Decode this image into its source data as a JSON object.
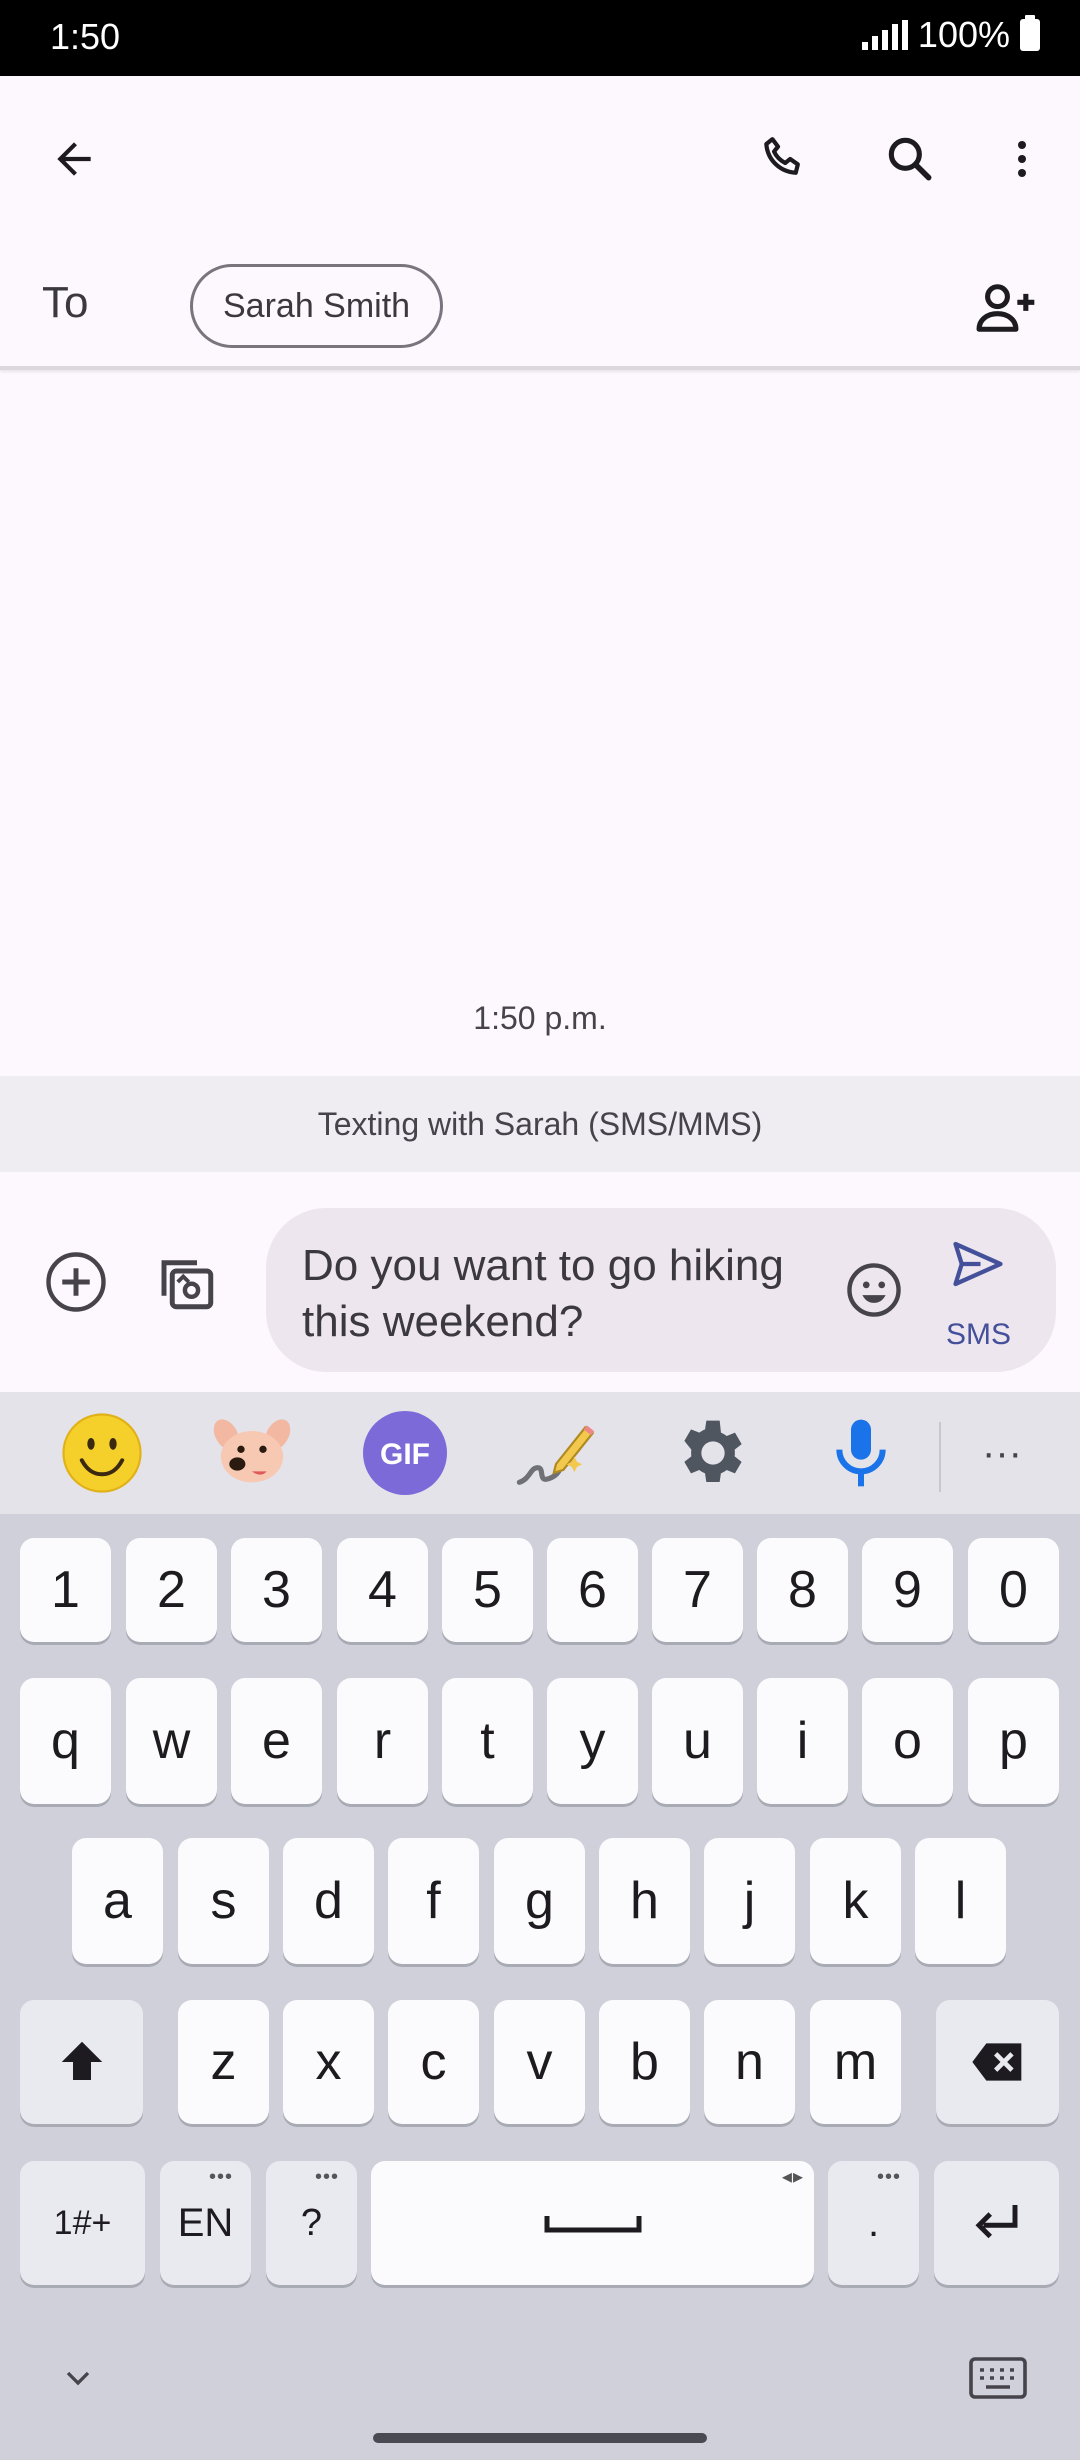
{
  "status_bar": {
    "time": "1:50",
    "battery": "100%"
  },
  "app_bar": {
    "back_icon": "arrow-back-icon",
    "call_icon": "phone-icon",
    "search_icon": "search-icon",
    "more_icon": "more-vert-icon"
  },
  "recipient": {
    "to_label": "To",
    "chip": "Sarah Smith",
    "add_icon": "add-person-icon"
  },
  "conversation": {
    "timestamp": "1:50 p.m.",
    "banner": "Texting with Sarah (SMS/MMS)"
  },
  "compose": {
    "message": "Do you want to go hiking this weekend?",
    "send_label": "SMS",
    "accent": "#44519a"
  },
  "keyboard": {
    "toolbar": [
      "emoji-icon",
      "sticker-icon",
      "gif-icon",
      "handwriting-icon",
      "settings-icon",
      "mic-icon",
      "more-icon"
    ],
    "gif_label": "GIF",
    "more_label": "···",
    "number_row": [
      "1",
      "2",
      "3",
      "4",
      "5",
      "6",
      "7",
      "8",
      "9",
      "0"
    ],
    "row1": [
      "q",
      "w",
      "e",
      "r",
      "t",
      "y",
      "u",
      "i",
      "o",
      "p"
    ],
    "row2": [
      "a",
      "s",
      "d",
      "f",
      "g",
      "h",
      "j",
      "k",
      "l"
    ],
    "row3": [
      "z",
      "x",
      "c",
      "v",
      "b",
      "n",
      "m"
    ],
    "symbols_label": "1#+",
    "lang_label": "EN",
    "question_label": "?",
    "period_label": ".",
    "dots": "•••",
    "arrows": "◂▸"
  }
}
